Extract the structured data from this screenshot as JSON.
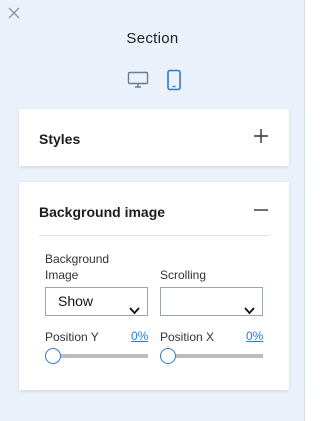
{
  "panel": {
    "title": "Section",
    "close_icon": "close-icon",
    "devices": [
      {
        "name": "desktop-icon",
        "active": false
      },
      {
        "name": "mobile-icon",
        "active": true
      }
    ]
  },
  "styles_card": {
    "title": "Styles",
    "toggle_icon": "plus-icon"
  },
  "background_card": {
    "title": "Background image",
    "toggle_icon": "minus-icon",
    "background_image_label": "Background Image",
    "background_image_value": "Show",
    "scrolling_label": "Scrolling",
    "scrolling_value": "",
    "position_y_label": "Position Y",
    "position_y_value": "0%",
    "position_y_level": 0,
    "position_x_label": "Position X",
    "position_x_value": "0%",
    "position_x_level": 0
  },
  "colors": {
    "panel_bg": "#eaf1fa",
    "accent": "#2a7ad6",
    "inactive_icon": "#6b7c8f"
  }
}
